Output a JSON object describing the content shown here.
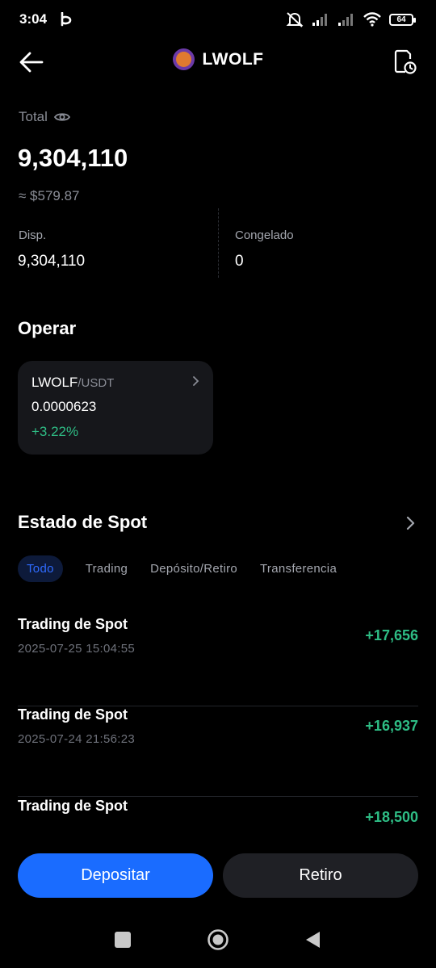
{
  "status_bar": {
    "time": "3:04",
    "battery": "64"
  },
  "header": {
    "coin": "LWOLF"
  },
  "balance": {
    "total_label": "Total",
    "total_value": "9,304,110",
    "usd_value": "≈ $579.87",
    "available_label": "Disp.",
    "available_value": "9,304,110",
    "frozen_label": "Congelado",
    "frozen_value": "0"
  },
  "operate": {
    "title": "Operar",
    "pair": {
      "base": "LWOLF",
      "quote": "/USDT",
      "price": "0.0000623",
      "change": "+3.22%"
    }
  },
  "spot": {
    "title": "Estado de Spot",
    "tabs": [
      {
        "label": "Todo",
        "active": true
      },
      {
        "label": "Trading",
        "active": false
      },
      {
        "label": "Depósito/Retiro",
        "active": false
      },
      {
        "label": "Transferencia",
        "active": false
      }
    ],
    "rows": [
      {
        "title": "Trading de Spot",
        "date": "2025-07-25 15:04:55",
        "amount": "+17,656"
      },
      {
        "title": "Trading de Spot",
        "date": "2025-07-24 21:56:23",
        "amount": "+16,937"
      },
      {
        "title": "Trading de Spot",
        "date": "",
        "amount": "+18,500"
      }
    ]
  },
  "actions": {
    "deposit": "Depositar",
    "withdraw": "Retiro"
  },
  "colors": {
    "accent": "#1a6cff",
    "positive": "#2ebd85",
    "background": "#000000"
  }
}
